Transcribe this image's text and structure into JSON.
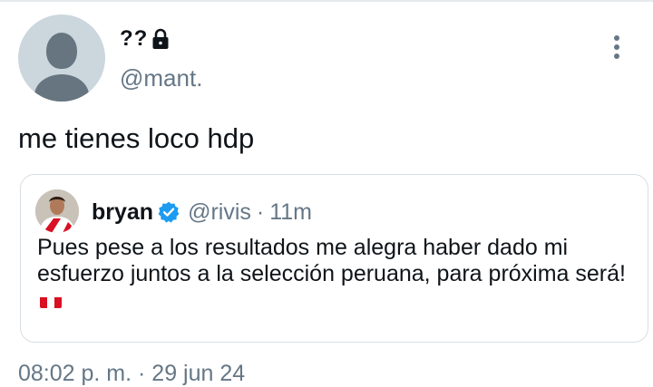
{
  "tweet": {
    "author": {
      "display_name": "??",
      "handle": "@mant.",
      "protected": true
    },
    "text": "me tienes loco hdp",
    "timestamp": "08:02 p. m. · 29 jun 24"
  },
  "quoted_tweet": {
    "author": {
      "display_name": "bryan",
      "handle": "@rivis",
      "verified": true
    },
    "separator": "·",
    "time": "11m",
    "text": "Pues pese a los resultados me alegra haber dado mi esfuerzo juntos a la selección peruana, para próxima será!",
    "emoji": "peru-flag"
  },
  "colors": {
    "secondary_text": "#657786",
    "verified_blue": "#1d9bf0",
    "border": "#d8dee3",
    "flag_red": "#d91023"
  },
  "icons": {
    "lock": "lock-icon",
    "more": "more-vertical-icon",
    "verified": "verified-badge-icon"
  }
}
